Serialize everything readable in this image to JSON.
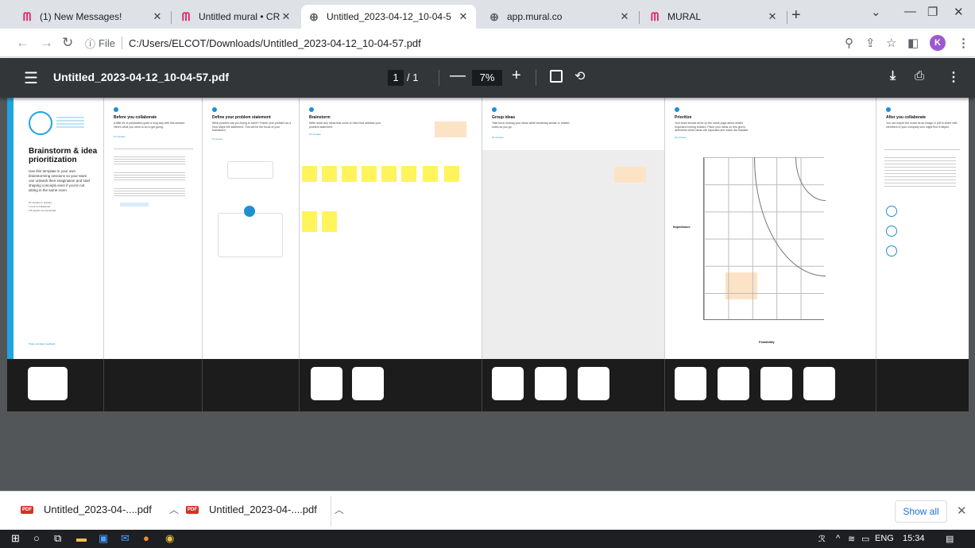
{
  "tabs": [
    {
      "title": "(1) New Messages!",
      "icon": "mural-icon",
      "active": false
    },
    {
      "title": "Untitled mural • CRM Applica",
      "icon": "mural-icon",
      "active": false
    },
    {
      "title": "Untitled_2023-04-12_10-04-5",
      "icon": "globe-icon",
      "active": true
    },
    {
      "title": "app.mural.co",
      "icon": "globe-icon",
      "active": false
    },
    {
      "title": "MURAL",
      "icon": "mural-icon",
      "active": false
    }
  ],
  "address": {
    "scheme": "File",
    "url": "C:/Users/ELCOT/Downloads/Untitled_2023-04-12_10-04-57.pdf"
  },
  "profile_initial": "K",
  "pdf": {
    "filename": "Untitled_2023-04-12_10-04-57.pdf",
    "current_page": "1",
    "total_pages": "/ 1",
    "zoom": "7%"
  },
  "mural": {
    "intro_title": "Brainstorm & idea prioritization",
    "intro_text": "Use this template in your own brainstorming sessions so your team can unleash their imagination and start shaping concepts even if you're not sitting in the same room.",
    "intro_meta": [
      "10 minutes to prepare",
      "1 hour to collaborate",
      "2-8 people recommended"
    ],
    "intro_foot": "Share template feedback",
    "sections": [
      {
        "heading": "Before you collaborate",
        "text": "A little bit of preparation goes a long way with this session. Here's what you need to do to get going.",
        "time": "10 minutes"
      },
      {
        "heading": "Define your problem statement",
        "text": "What problem are you trying to solve? Frame your problem as a How Might We statement. This will be the focus of your brainstorm.",
        "time": "5 minutes"
      },
      {
        "heading": "Brainstorm",
        "text": "Write down any ideas that come to mind that address your problem statement.",
        "time": "10 minutes"
      },
      {
        "heading": "Group ideas",
        "text": "Take turns sharing your ideas while clustering similar or related notes as you go.",
        "time": "20 minutes"
      },
      {
        "heading": "Prioritize",
        "text": "Your team should all be on the same page about what's important moving forward. Place your ideas on this grid to determine which ideas are important and which are feasible.",
        "time": "20 minutes"
      },
      {
        "heading": "After you collaborate",
        "text": "You can export the mural as an image or pdf to share with members of your company who might find it helpful.",
        "time": ""
      }
    ],
    "prioritize_axis_y": "Importance",
    "prioritize_axis_x": "Feasibility"
  },
  "downloads": [
    {
      "name": "Untitled_2023-04-....pdf"
    },
    {
      "name": "Untitled_2023-04-....pdf"
    }
  ],
  "shelf_show_all": "Show all",
  "taskbar": {
    "language": "ENG",
    "time": "15:34"
  }
}
